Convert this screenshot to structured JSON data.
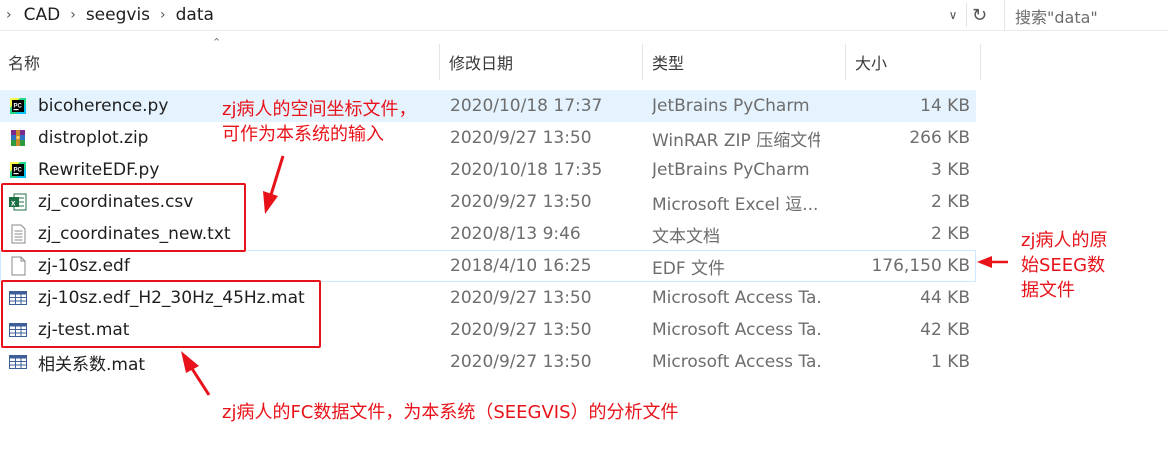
{
  "breadcrumb": [
    "CAD",
    "seegvis",
    "data"
  ],
  "search": {
    "placeholder": "搜索\"data\""
  },
  "columns": {
    "name": "名称",
    "date": "修改日期",
    "type": "类型",
    "size": "大小"
  },
  "files": [
    {
      "name": "bicoherence.py",
      "date": "2020/10/18 17:37",
      "type": "JetBrains PyCharm",
      "size": "14 KB",
      "icon": "pycharm-icon"
    },
    {
      "name": "distroplot.zip",
      "date": "2020/9/27 13:50",
      "type": "WinRAR ZIP 压缩文件",
      "size": "266 KB",
      "icon": "winrar-icon"
    },
    {
      "name": "RewriteEDF.py",
      "date": "2020/10/18 17:35",
      "type": "JetBrains PyCharm",
      "size": "3 KB",
      "icon": "pycharm-icon"
    },
    {
      "name": "zj_coordinates.csv",
      "date": "2020/9/27 13:50",
      "type": "Microsoft Excel 逗...",
      "size": "2 KB",
      "icon": "excel-icon"
    },
    {
      "name": "zj_coordinates_new.txt",
      "date": "2020/8/13 9:46",
      "type": "文本文档",
      "size": "2 KB",
      "icon": "text-file-icon"
    },
    {
      "name": "zj-10sz.edf",
      "date": "2018/4/10 16:25",
      "type": "EDF 文件",
      "size": "176,150 KB",
      "icon": "blank-file-icon"
    },
    {
      "name": "zj-10sz.edf_H2_30Hz_45Hz.mat",
      "date": "2020/9/27 13:50",
      "type": "Microsoft Access Ta...",
      "size": "44 KB",
      "icon": "access-table-icon"
    },
    {
      "name": "zj-test.mat",
      "date": "2020/9/27 13:50",
      "type": "Microsoft Access Ta...",
      "size": "42 KB",
      "icon": "access-table-icon"
    },
    {
      "name": "相关系数.mat",
      "date": "2020/9/27 13:50",
      "type": "Microsoft Access Ta...",
      "size": "1 KB",
      "icon": "access-table-icon"
    }
  ],
  "annotations": {
    "coords": [
      "zj病人的空间坐标文件，",
      "可作为本系统的输入"
    ],
    "edf": [
      "zj病人的原",
      "始SEEG数",
      "据文件"
    ],
    "fc": "zj病人的FC数据文件，为本系统（SEEGVIS）的分析文件"
  },
  "colors": {
    "annotation": "#e8131a",
    "selected_row": "#e5f3ff",
    "secondary_text": "#6d6d6d"
  }
}
